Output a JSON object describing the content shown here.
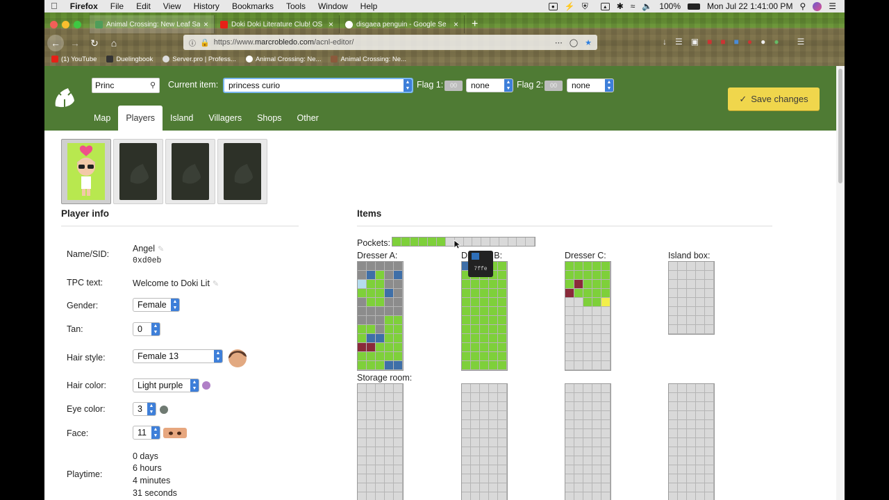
{
  "menubar": {
    "apple": "",
    "app": "Firefox",
    "items": [
      "File",
      "Edit",
      "View",
      "History",
      "Bookmarks",
      "Tools",
      "Window",
      "Help"
    ],
    "battery": "100%",
    "clock": "Mon Jul 22  1:41:00 PM"
  },
  "browser": {
    "tabs": [
      {
        "title": "Animal Crossing: New Leaf Sa",
        "icon": "animal-crossing-icon"
      },
      {
        "title": "Doki Doki Literature Club! OS",
        "icon": "youtube-icon"
      },
      {
        "title": "disgaea penguin - Google Se",
        "icon": "google-icon"
      }
    ],
    "url_prefix": "https://www.",
    "url_domain": "marcrobledo.com",
    "url_path": "/acnl-editor/",
    "bookmarks": [
      "(1) YouTube",
      "Duelingbook",
      "Server.pro | Profess...",
      "Animal Crossing: Ne...",
      "Animal Crossing: Ne..."
    ]
  },
  "header": {
    "search_value": "Princ",
    "current_item_label": "Current item:",
    "current_item_value": "princess curio",
    "flag1_label": "Flag 1:",
    "flag1_value": "00",
    "flag1_select": "none",
    "flag2_label": "Flag 2:",
    "flag2_value": "00",
    "flag2_select": "none",
    "save_label": "Save changes",
    "tabs": [
      "Map",
      "Players",
      "Island",
      "Villagers",
      "Shops",
      "Other"
    ],
    "active_tab": "Players"
  },
  "player_info": {
    "title": "Player info",
    "name_label": "Name/SID:",
    "name": "Angel",
    "sid": "0xd0eb",
    "tpc_label": "TPC text:",
    "tpc": "Welcome to Doki Lit",
    "gender_label": "Gender:",
    "gender": "Female",
    "tan_label": "Tan:",
    "tan": "0",
    "hair_style_label": "Hair style:",
    "hair_style": "Female 13",
    "hair_color_label": "Hair color:",
    "hair_color": "Light purple",
    "hair_color_hex": "#b07fc7",
    "eye_color_label": "Eye color:",
    "eye_color": "3",
    "eye_color_hex": "#6f7a72",
    "face_label": "Face:",
    "face": "11",
    "playtime_label": "Playtime:",
    "playtime_days": "0 days",
    "playtime_hours": "6 hours",
    "playtime_minutes": "4 minutes",
    "playtime_seconds": "31 seconds"
  },
  "items": {
    "title": "Items",
    "pockets_label": "Pockets:",
    "dresser_a_label": "Dresser A:",
    "dresser_b_label": "Dresser B:",
    "dresser_c_label": "Dresser C:",
    "island_box_label": "Island box:",
    "storage_label": "Storage room:",
    "tooltip": "7ffe",
    "colors": {
      "empty": "#d9d9d9",
      "green": "#7ed03a",
      "blue": "#3e6fa8",
      "gray": "#8c8c8c",
      "lightblue": "#b5dcee",
      "red": "#8a2a3a",
      "yellow": "#f2ef4a"
    },
    "pockets": [
      "green",
      "green",
      "green",
      "green",
      "green",
      "green",
      "empty",
      "empty",
      "empty",
      "empty",
      "empty",
      "empty",
      "empty",
      "empty",
      "empty",
      "empty"
    ],
    "dresser_a": [
      [
        "gray",
        "gray",
        "gray",
        "gray",
        "gray"
      ],
      [
        "gray",
        "blue",
        "green",
        "gray",
        "blue"
      ],
      [
        "lightblue",
        "green",
        "green",
        "gray",
        "gray"
      ],
      [
        "green",
        "green",
        "green",
        "blue",
        "gray"
      ],
      [
        "gray",
        "green",
        "green",
        "gray",
        "gray"
      ],
      [
        "gray",
        "gray",
        "gray",
        "gray",
        "gray"
      ],
      [
        "gray",
        "gray",
        "gray",
        "green",
        "green"
      ],
      [
        "green",
        "green",
        "gray",
        "green",
        "green"
      ],
      [
        "green",
        "blue",
        "blue",
        "green",
        "green"
      ],
      [
        "red",
        "red",
        "green",
        "green",
        "green"
      ],
      [
        "green",
        "green",
        "green",
        "green",
        "green"
      ],
      [
        "green",
        "green",
        "green",
        "blue",
        "blue"
      ]
    ],
    "dresser_b": [
      [
        "blue",
        "blue",
        "green",
        "green",
        "green"
      ],
      [
        "green",
        "green",
        "green",
        "green",
        "green"
      ],
      [
        "green",
        "green",
        "green",
        "green",
        "green"
      ],
      [
        "green",
        "green",
        "green",
        "green",
        "green"
      ],
      [
        "green",
        "green",
        "green",
        "green",
        "green"
      ],
      [
        "green",
        "green",
        "green",
        "green",
        "green"
      ],
      [
        "green",
        "green",
        "green",
        "green",
        "green"
      ],
      [
        "green",
        "green",
        "green",
        "green",
        "green"
      ],
      [
        "green",
        "green",
        "green",
        "green",
        "green"
      ],
      [
        "green",
        "green",
        "green",
        "green",
        "green"
      ],
      [
        "green",
        "green",
        "green",
        "green",
        "green"
      ],
      [
        "green",
        "green",
        "green",
        "green",
        "green"
      ]
    ],
    "dresser_c": [
      [
        "green",
        "green",
        "green",
        "green",
        "green"
      ],
      [
        "green",
        "green",
        "green",
        "green",
        "green"
      ],
      [
        "green",
        "red",
        "green",
        "green",
        "green"
      ],
      [
        "red",
        "green",
        "green",
        "green",
        "green"
      ],
      [
        "empty",
        "empty",
        "green",
        "green",
        "yellow"
      ],
      [
        "empty",
        "empty",
        "empty",
        "empty",
        "empty"
      ],
      [
        "empty",
        "empty",
        "empty",
        "empty",
        "empty"
      ],
      [
        "empty",
        "empty",
        "empty",
        "empty",
        "empty"
      ],
      [
        "empty",
        "empty",
        "empty",
        "empty",
        "empty"
      ],
      [
        "empty",
        "empty",
        "empty",
        "empty",
        "empty"
      ],
      [
        "empty",
        "empty",
        "empty",
        "empty",
        "empty"
      ],
      [
        "empty",
        "empty",
        "empty",
        "empty",
        "empty"
      ]
    ]
  }
}
